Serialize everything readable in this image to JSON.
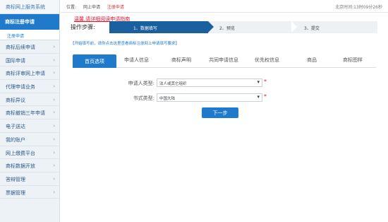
{
  "sidebar": {
    "title": "商标网上服务系统",
    "active": "商标注册申请",
    "active_sub": "注册申请",
    "items": [
      {
        "label": "商标后续申请"
      },
      {
        "label": "国际申请"
      },
      {
        "label": "商标评审网上申请"
      },
      {
        "label": "代理申请业务"
      },
      {
        "label": "商标异议"
      },
      {
        "label": "商标撤销三年申请"
      },
      {
        "label": "电子送达"
      },
      {
        "label": "我的账户"
      },
      {
        "label": "网上缴费平台"
      },
      {
        "label": "商标数据开放"
      },
      {
        "label": "答辩管理"
      },
      {
        "label": "票据管理"
      }
    ]
  },
  "topbar": {
    "position_label": "位置:",
    "crumb1": "网上申请",
    "crumb2": "注册申请",
    "clock": "北京时间:13时09分26秒"
  },
  "guide_link": "温馨,请详细阅读申请指南",
  "steps": {
    "label": "操作步骤:",
    "items": [
      "1、数据填写",
      "2、预览",
      "3、提交"
    ]
  },
  "hint": "【开始填写前，请你点击这里查看商标注册网上申请填写要求】",
  "tabs": [
    "首页选项",
    "申请人信息",
    "商标声明",
    "共同申请信息",
    "优先权信息",
    "商品",
    "商标图样"
  ],
  "form": {
    "applicant_type_label": "申请人类型:",
    "applicant_type_value": "法人或其它组织",
    "document_type_label": "书式类型:",
    "document_type_value": "中国大陆",
    "next_button": "下一步"
  }
}
